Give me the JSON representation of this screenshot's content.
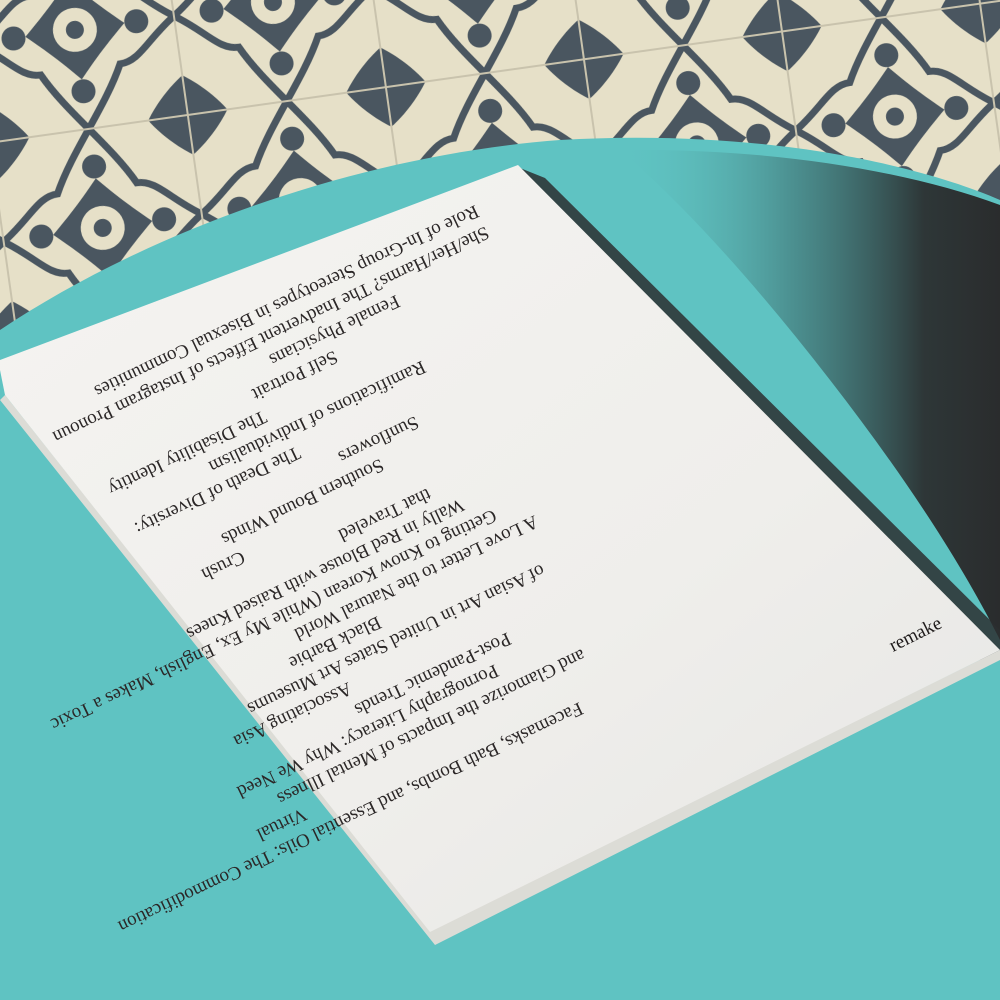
{
  "book": {
    "cover_titles": [
      "Role of In-Group Stereotypes in Bisexual Communities",
      "She/Her/Harms? The Inadvertent Effects of Instagram Pronoun",
      "Female Physicians",
      "Self Portrait",
      "The Disability Identity",
      "Ramifications of Individualism",
      "The Death of Diversity:",
      "Sunflowers",
      "Southern Bound Winds",
      "Crush",
      "that Traveled",
      "Wally in Red Blouse with Raised Knees",
      "Getting to Know Korean (While My Ex, English, Makes a Toxic",
      "A Love Letter to the Natural World",
      "Black Barbie",
      "of Asian Art in United States Art Museums",
      "Associating Asia",
      "Post-Pandemic Trends",
      "Pornography Literacy: Why We Need",
      "and Glamorize the Impacts of Mental Illness",
      "Virtual",
      "Facemasks, Bath Bombs, and Essential Oils: The Commodification"
    ],
    "brand": "remake"
  },
  "colors": {
    "table": "#5fc3c2",
    "tile_light": "#e6e0c8",
    "tile_dark": "#4a5660",
    "paper": "#f3f2ef",
    "ink": "#2b2727",
    "shadow": "#2f3334"
  }
}
